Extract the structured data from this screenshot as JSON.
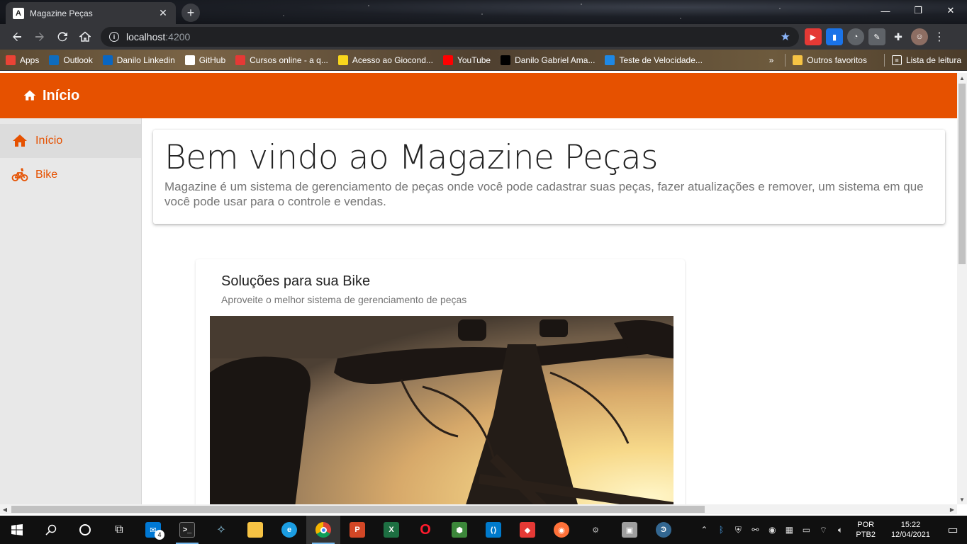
{
  "browser": {
    "tab_title": "Magazine Peças",
    "tab_favicon": "A",
    "url_host": "localhost",
    "url_port": ":4200",
    "bookmarks": [
      {
        "label": "Apps",
        "icon": "apps-grid-icon",
        "color": "#ea4335"
      },
      {
        "label": "Outlook",
        "icon": "outlook-icon",
        "color": "#0f6cbd"
      },
      {
        "label": "Danilo Linkedin",
        "icon": "linkedin-icon",
        "color": "#0a66c2"
      },
      {
        "label": "GitHub",
        "icon": "github-icon",
        "color": "#ffffff"
      },
      {
        "label": "Cursos online - a q...",
        "icon": "cursos-icon",
        "color": "#e53935"
      },
      {
        "label": "Acesso ao Giocond...",
        "icon": "giocond-icon",
        "color": "#f9d71c"
      },
      {
        "label": "YouTube",
        "icon": "youtube-icon",
        "color": "#ff0000"
      },
      {
        "label": "Danilo Gabriel Ama...",
        "icon": "profile-bookmark-icon",
        "color": "#000000"
      },
      {
        "label": "Teste de Velocidade...",
        "icon": "speedtest-icon",
        "color": "#1e88e5"
      }
    ],
    "more_bookmarks": "»",
    "other_favorites": "Outros favoritos",
    "reading_list": "Lista de leitura"
  },
  "header": {
    "title": "Início"
  },
  "sidenav": {
    "items": [
      {
        "label": "Início",
        "icon": "home-icon"
      },
      {
        "label": "Bike",
        "icon": "bike-icon"
      }
    ]
  },
  "jumbotron": {
    "title": "Bem vindo ao Magazine Peças",
    "description": "Magazine é um sistema de gerenciamento de peças onde você pode cadastrar suas peças, fazer atualizações e remover, um sistema em que você pode usar para o controle e vendas."
  },
  "card": {
    "title": "Soluções para sua Bike",
    "subtitle": "Aproveite o melhor sistema de gerenciamento de peças"
  },
  "taskbar": {
    "mail_badge": "4",
    "language": "POR",
    "keyboard": "PTB2",
    "time": "15:22",
    "date": "12/04/2021"
  },
  "colors": {
    "primary": "#e65100",
    "sidenav_bg": "#e8e8e8"
  }
}
